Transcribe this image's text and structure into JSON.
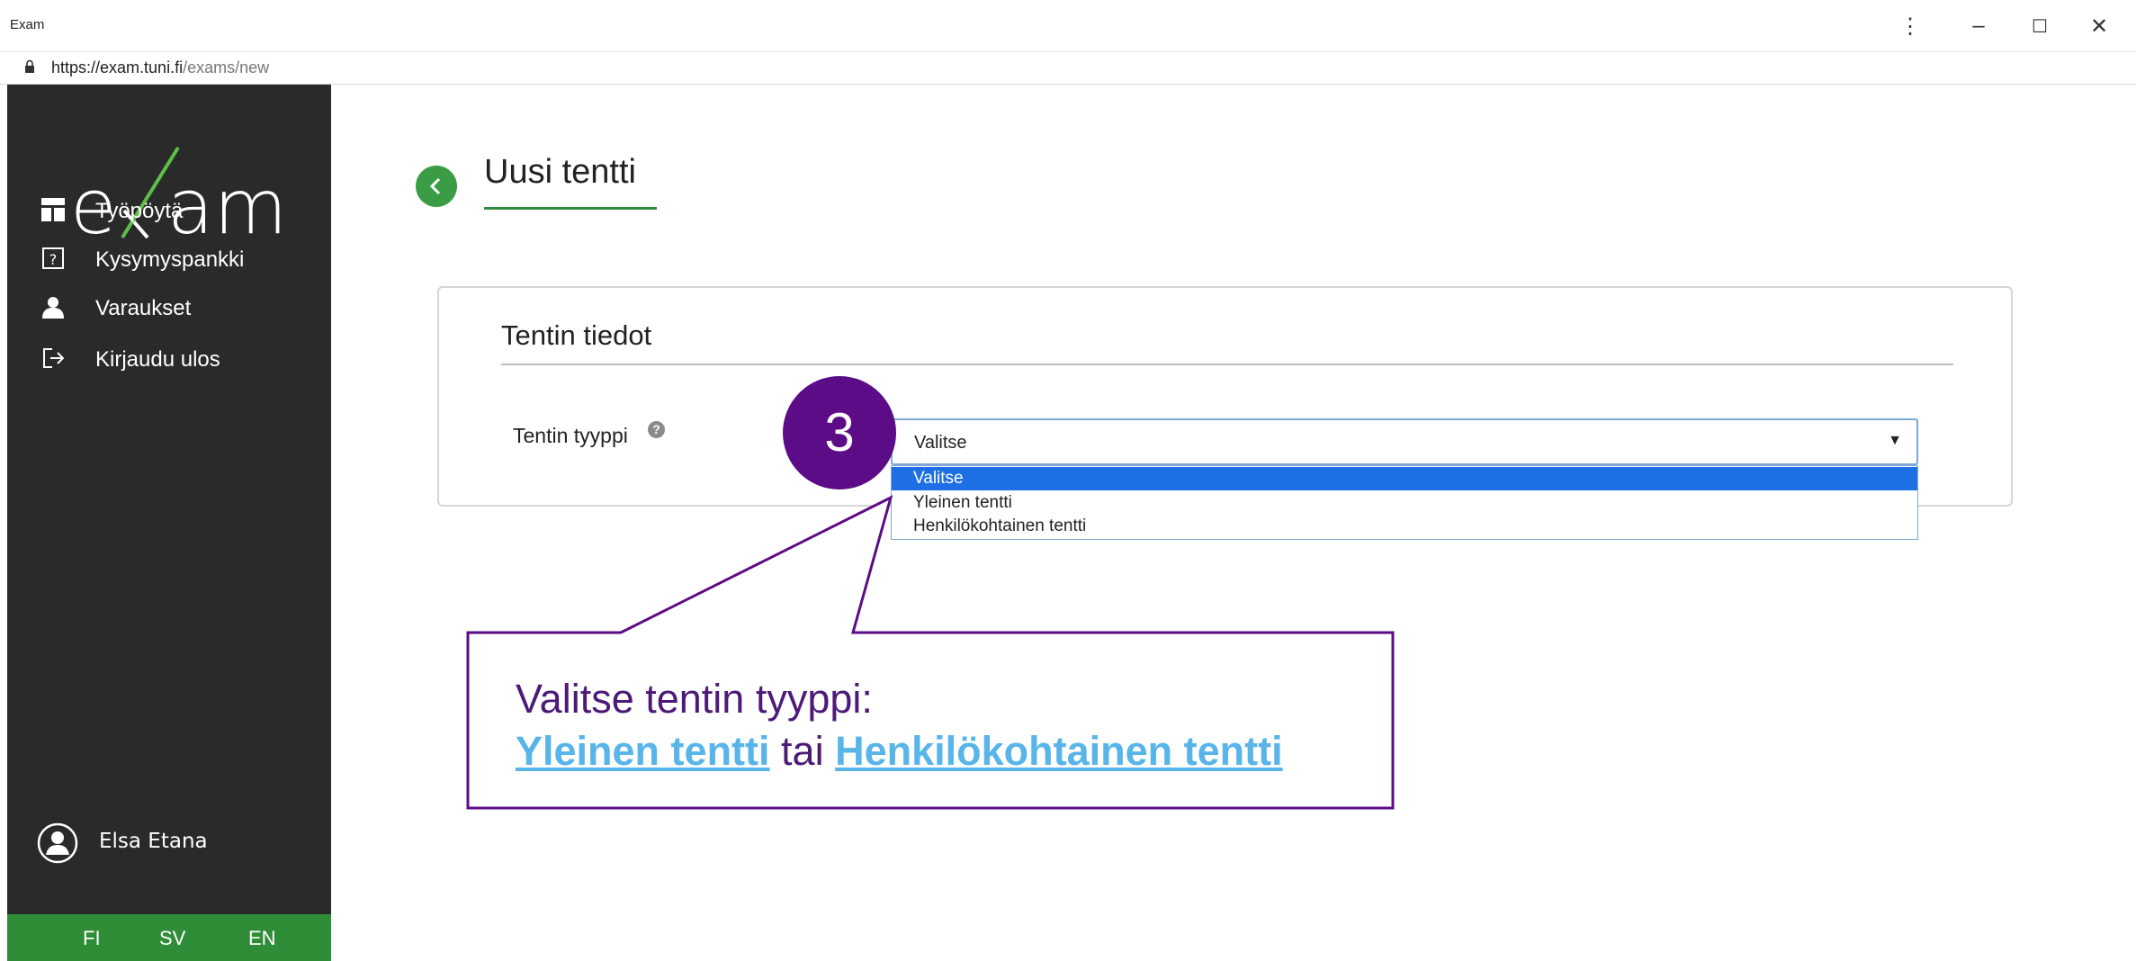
{
  "window": {
    "title": "Exam",
    "url_host": "https://exam.tuni.fi",
    "url_path": "/exams/new",
    "controls": {
      "menu": "⋮",
      "minimize": "–",
      "maximize": "☐",
      "close": "✕"
    }
  },
  "sidebar": {
    "logo_text": "exam",
    "items": [
      {
        "label": "Työpöytä",
        "icon": "dashboard-icon"
      },
      {
        "label": "Kysymyspankki",
        "icon": "question-bank-icon"
      },
      {
        "label": "Varaukset",
        "icon": "person-icon"
      },
      {
        "label": "Kirjaudu ulos",
        "icon": "logout-icon"
      }
    ],
    "user_name": "Elsa Etana",
    "languages": [
      "FI",
      "SV",
      "EN"
    ]
  },
  "main": {
    "title": "Uusi tentti",
    "card_title": "Tentin tiedot",
    "field_label": "Tentin tyyppi",
    "select": {
      "value": "Valitse",
      "options": [
        "Valitse",
        "Yleinen tentti",
        "Henkilökohtainen tentti"
      ],
      "highlighted_option": "Valitse"
    }
  },
  "tutorial": {
    "step_number": "3",
    "line1": "Valitse tentin tyyppi:",
    "option1": "Yleinen tentti",
    "connector": "tai",
    "option2": "Henkilökohtainen tentti"
  },
  "colors": {
    "sidebar": "#2a2a2a",
    "accent_green": "#2f8c37",
    "tutorial_purple": "#5b0c86",
    "link_blue": "#58b5e9",
    "dropdown_highlight": "#1e6fe3"
  }
}
